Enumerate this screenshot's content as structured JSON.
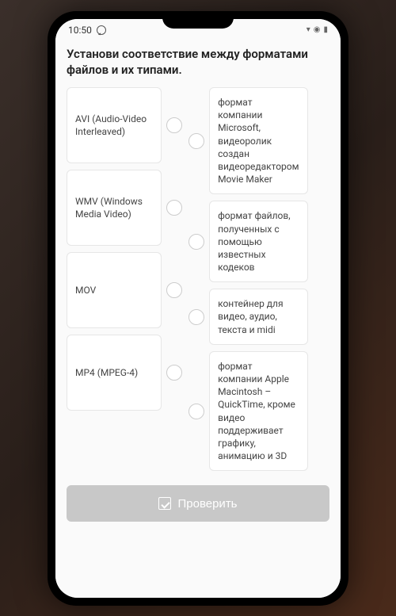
{
  "status": {
    "time": "10:50",
    "icons_right": "⁂ ⋮ ⫶"
  },
  "question": {
    "title": "Установи соответствие между форматами файлов и их типами."
  },
  "left_items": [
    {
      "label": "AVI (Audio-Video Interleaved)"
    },
    {
      "label": "WMV (Windows Media Video)"
    },
    {
      "label": "MOV"
    },
    {
      "label": "MP4 (MPEG-4)"
    }
  ],
  "right_items": [
    {
      "label": "формат компании Microsoft, видеоролик создан видеоредактором Movie Maker"
    },
    {
      "label": "формат файлов, полученных с помощью известных кодеков"
    },
    {
      "label": "контейнер для видео, аудио, текста и midi"
    },
    {
      "label": "формат компании Apple Macintosh – QuickTime, кроме видео поддерживает графику, анимацию и 3D"
    }
  ],
  "button": {
    "check_label": "Проверить"
  }
}
